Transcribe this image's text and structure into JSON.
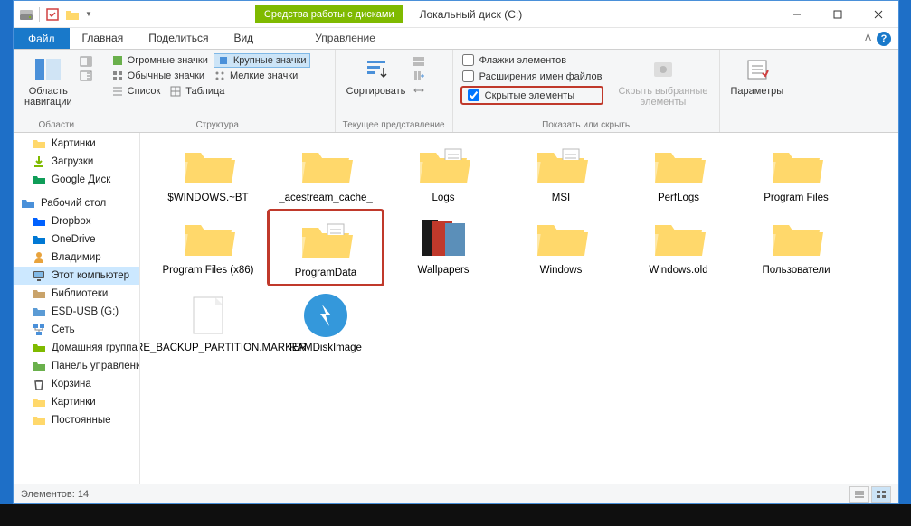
{
  "window": {
    "title_tab": "Средства работы с дисками",
    "title": "Локальный диск (C:)"
  },
  "tabs": {
    "file": "Файл",
    "home": "Главная",
    "share": "Поделиться",
    "view": "Вид",
    "manage": "Управление"
  },
  "ribbon": {
    "panes": {
      "nav": "Область\nнавигации",
      "group": "Области"
    },
    "layout": {
      "huge": "Огромные значки",
      "large": "Крупные значки",
      "normal": "Обычные значки",
      "small": "Мелкие значки",
      "list": "Список",
      "table": "Таблица",
      "group": "Структура"
    },
    "current": {
      "sort": "Сортировать",
      "group": "Текущее представление"
    },
    "showhide": {
      "checkboxes": "Флажки элементов",
      "extensions": "Расширения имен файлов",
      "hidden": "Скрытые элементы",
      "hide_selected": "Скрыть выбранные\nэлементы",
      "group": "Показать или скрыть"
    },
    "options": {
      "label": "Параметры"
    }
  },
  "sidebar": [
    {
      "label": "Картинки",
      "icon": "folder-yellow"
    },
    {
      "label": "Загрузки",
      "icon": "download"
    },
    {
      "label": "Google Диск",
      "icon": "gdrive"
    },
    {
      "label": "Рабочий стол",
      "icon": "desktop",
      "root": true
    },
    {
      "label": "Dropbox",
      "icon": "dropbox"
    },
    {
      "label": "OneDrive",
      "icon": "onedrive"
    },
    {
      "label": "Владимир",
      "icon": "user"
    },
    {
      "label": "Этот компьютер",
      "icon": "pc",
      "selected": true
    },
    {
      "label": "Библиотеки",
      "icon": "library"
    },
    {
      "label": "ESD-USB (G:)",
      "icon": "drive"
    },
    {
      "label": "Сеть",
      "icon": "network"
    },
    {
      "label": "Домашняя группа",
      "icon": "homegroup"
    },
    {
      "label": "Панель управления",
      "icon": "control"
    },
    {
      "label": "Корзина",
      "icon": "recycle"
    },
    {
      "label": "Картинки",
      "icon": "folder-yellow"
    },
    {
      "label": "Постоянные",
      "icon": "folder-yellow"
    }
  ],
  "items": [
    {
      "label": "$WINDOWS.~BT",
      "type": "folder"
    },
    {
      "label": "_acestream_cache_",
      "type": "folder"
    },
    {
      "label": "Logs",
      "type": "folder-docs"
    },
    {
      "label": "MSI",
      "type": "folder-docs"
    },
    {
      "label": "PerfLogs",
      "type": "folder"
    },
    {
      "label": "Program Files",
      "type": "folder"
    },
    {
      "label": "Program Files (x86)",
      "type": "folder"
    },
    {
      "label": "ProgramData",
      "type": "folder-docs",
      "highlight": true
    },
    {
      "label": "Wallpapers",
      "type": "wallpaper"
    },
    {
      "label": "Windows",
      "type": "folder"
    },
    {
      "label": "Windows.old",
      "type": "folder"
    },
    {
      "label": "Пользователи",
      "type": "folder"
    },
    {
      "label": "$WINRE_BACKUP_PARTITION.MARKER",
      "type": "file"
    },
    {
      "label": "RAMDiskImage",
      "type": "ramdisk"
    }
  ],
  "status": {
    "count": "Элементов: 14"
  }
}
